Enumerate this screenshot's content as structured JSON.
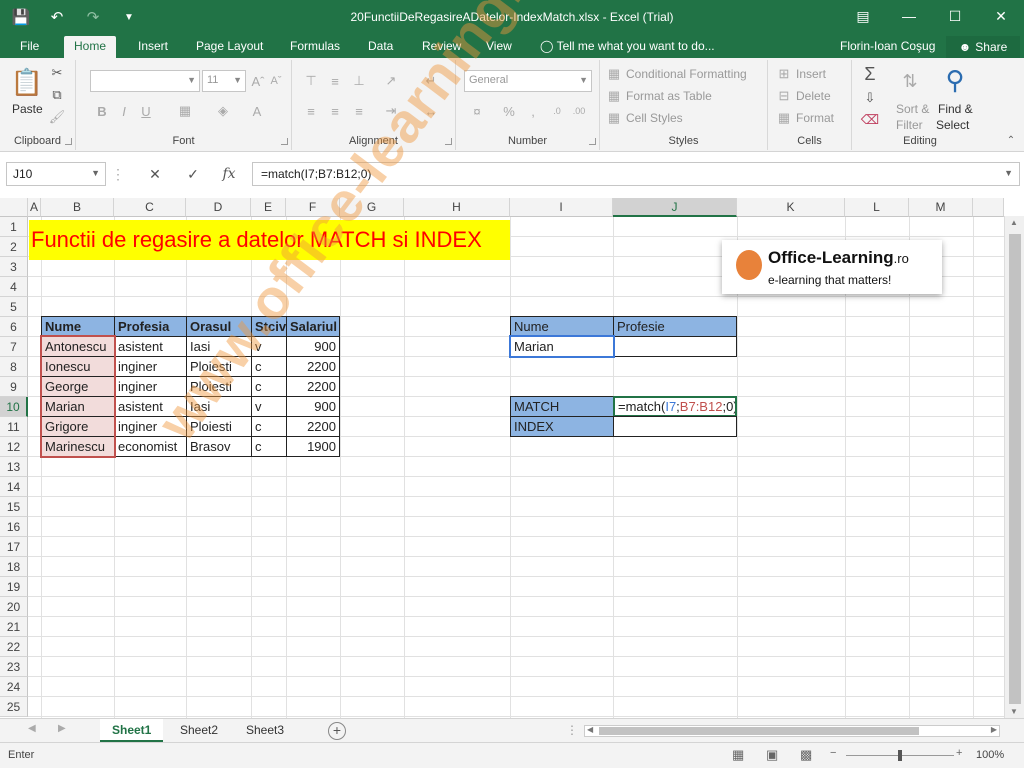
{
  "window": {
    "title": "20FunctiiDeRegasireADatelor-IndexMatch.xlsx - Excel (Trial)",
    "user": "Florin-Ioan Coşug",
    "share_label": "Share"
  },
  "tabs": [
    "File",
    "Home",
    "Insert",
    "Page Layout",
    "Formulas",
    "Data",
    "Review",
    "View"
  ],
  "active_tab": "Home",
  "tell_me": "Tell me what you want to do...",
  "ribbon": {
    "clipboard": {
      "label": "Clipboard",
      "paste": "Paste"
    },
    "font": {
      "label": "Font",
      "size": "11",
      "bold": "B",
      "italic": "I",
      "underline": "U"
    },
    "alignment": {
      "label": "Alignment"
    },
    "number": {
      "label": "Number",
      "format": "General",
      "pct": "%"
    },
    "styles": {
      "label": "Styles",
      "conditional": "Conditional Formatting",
      "format_table": "Format as Table",
      "cell_styles": "Cell Styles"
    },
    "cells": {
      "label": "Cells",
      "insert": "Insert",
      "delete": "Delete",
      "format": "Format"
    },
    "editing": {
      "label": "Editing",
      "sort": "Sort &",
      "filter": "Filter",
      "find": "Find &",
      "select": "Select"
    }
  },
  "formula_bar": {
    "name_box": "J10",
    "fx": "fx",
    "formula": "=match(I7;B7:B12;0)"
  },
  "columns": [
    "A",
    "B",
    "C",
    "D",
    "E",
    "F",
    "G",
    "H",
    "I",
    "J",
    "K",
    "L",
    "M"
  ],
  "rows": [
    "1",
    "2",
    "3",
    "4",
    "5",
    "6",
    "7",
    "8",
    "9",
    "10",
    "11",
    "12",
    "13",
    "14",
    "15",
    "16",
    "17",
    "18",
    "19",
    "20",
    "21",
    "22",
    "23",
    "24",
    "25"
  ],
  "banner": "Functii de regasire a datelor MATCH si INDEX",
  "table": {
    "headers": [
      "Nume",
      "Profesia",
      "Orasul",
      "Stciv",
      "Salariul"
    ],
    "rows": [
      [
        "Antonescu",
        "asistent",
        "Iasi",
        "v",
        "900"
      ],
      [
        "Ionescu",
        "inginer",
        "Ploiesti",
        "c",
        "2200"
      ],
      [
        "George",
        "inginer",
        "Ploiesti",
        "c",
        "2200"
      ],
      [
        "Marian",
        "asistent",
        "Iasi",
        "v",
        "900"
      ],
      [
        "Grigore",
        "inginer",
        "Ploiesti",
        "c",
        "2200"
      ],
      [
        "Marinescu",
        "economist",
        "Brasov",
        "c",
        "1900"
      ]
    ]
  },
  "lookup": {
    "nume_label": "Nume",
    "profesie_label": "Profesie",
    "nume_value": "Marian",
    "match_label": "MATCH",
    "index_label": "INDEX",
    "match_formula_prefix": "=match(",
    "match_ref1": "I7",
    "match_sep1": ";",
    "match_ref2": "B7:B12",
    "match_suffix": ";0)"
  },
  "logo": {
    "name": "Office-Learning",
    "suffix": ".ro",
    "tagline": "e-learning that matters!"
  },
  "watermark": "www.office-learning.ro",
  "sheets": [
    "Sheet1",
    "Sheet2",
    "Sheet3"
  ],
  "active_sheet": "Sheet1",
  "status": {
    "mode": "Enter",
    "zoom": "100%"
  },
  "colors": {
    "excel_green": "#217346",
    "header_blue": "#8db4e2",
    "banner_yellow": "#ffff00",
    "banner_red": "#ff0000",
    "ref_blue": "#3c78d8",
    "ref_red": "#c0504d"
  }
}
